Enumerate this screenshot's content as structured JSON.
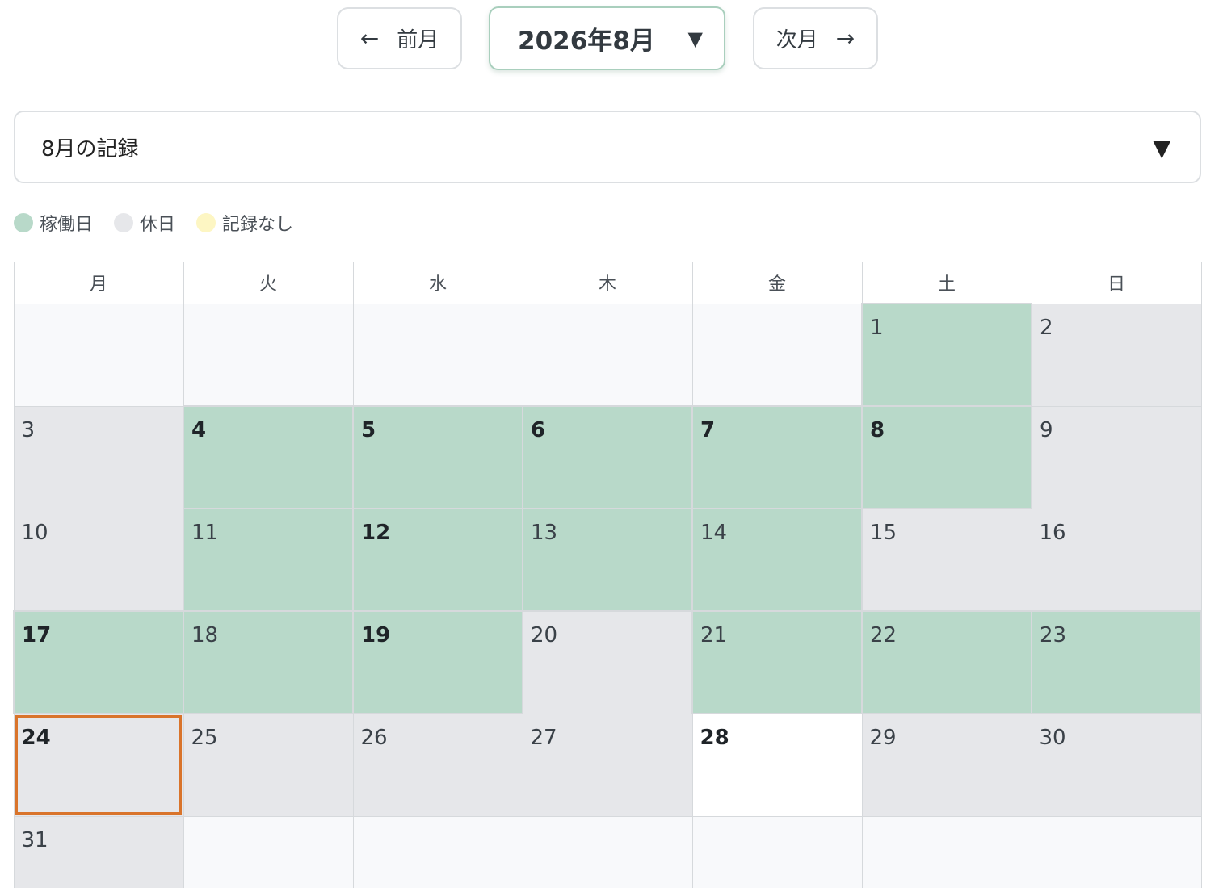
{
  "nav": {
    "prev_arrow": "←",
    "prev_label": "前月",
    "current_month": "2026年8月",
    "caret": "▼",
    "next_label": "次月",
    "next_arrow": "→"
  },
  "records": {
    "label": "8月の記録",
    "caret": "▼"
  },
  "legend": [
    {
      "label": "稼働日",
      "color": "#b8d9c9"
    },
    {
      "label": "休日",
      "color": "#e6e7ea"
    },
    {
      "label": "記録なし",
      "color": "#fdf6c3"
    }
  ],
  "calendar": {
    "weekdays": [
      "月",
      "火",
      "水",
      "木",
      "金",
      "土",
      "日"
    ],
    "weeks": [
      [
        {
          "day": "",
          "status": "empty"
        },
        {
          "day": "",
          "status": "empty"
        },
        {
          "day": "",
          "status": "empty"
        },
        {
          "day": "",
          "status": "empty"
        },
        {
          "day": "",
          "status": "empty"
        },
        {
          "day": "1",
          "status": "work"
        },
        {
          "day": "2",
          "status": "holiday"
        }
      ],
      [
        {
          "day": "3",
          "status": "holiday"
        },
        {
          "day": "4",
          "status": "work",
          "bold": true
        },
        {
          "day": "5",
          "status": "work",
          "bold": true
        },
        {
          "day": "6",
          "status": "work",
          "bold": true
        },
        {
          "day": "7",
          "status": "work",
          "bold": true
        },
        {
          "day": "8",
          "status": "work",
          "bold": true
        },
        {
          "day": "9",
          "status": "holiday"
        }
      ],
      [
        {
          "day": "10",
          "status": "holiday"
        },
        {
          "day": "11",
          "status": "work"
        },
        {
          "day": "12",
          "status": "work",
          "bold": true
        },
        {
          "day": "13",
          "status": "work"
        },
        {
          "day": "14",
          "status": "work"
        },
        {
          "day": "15",
          "status": "holiday"
        },
        {
          "day": "16",
          "status": "holiday"
        }
      ],
      [
        {
          "day": "17",
          "status": "work",
          "bold": true
        },
        {
          "day": "18",
          "status": "work"
        },
        {
          "day": "19",
          "status": "work",
          "bold": true
        },
        {
          "day": "20",
          "status": "holiday"
        },
        {
          "day": "21",
          "status": "work"
        },
        {
          "day": "22",
          "status": "work"
        },
        {
          "day": "23",
          "status": "work"
        }
      ],
      [
        {
          "day": "24",
          "status": "holiday",
          "bold": true,
          "today": true
        },
        {
          "day": "25",
          "status": "holiday"
        },
        {
          "day": "26",
          "status": "holiday"
        },
        {
          "day": "27",
          "status": "holiday"
        },
        {
          "day": "28",
          "status": "norecord",
          "bold": true
        },
        {
          "day": "29",
          "status": "holiday"
        },
        {
          "day": "30",
          "status": "holiday"
        }
      ],
      [
        {
          "day": "31",
          "status": "holiday"
        },
        {
          "day": "",
          "status": "empty"
        },
        {
          "day": "",
          "status": "empty"
        },
        {
          "day": "",
          "status": "empty"
        },
        {
          "day": "",
          "status": "empty"
        },
        {
          "day": "",
          "status": "empty"
        },
        {
          "day": "",
          "status": "empty"
        }
      ]
    ]
  }
}
